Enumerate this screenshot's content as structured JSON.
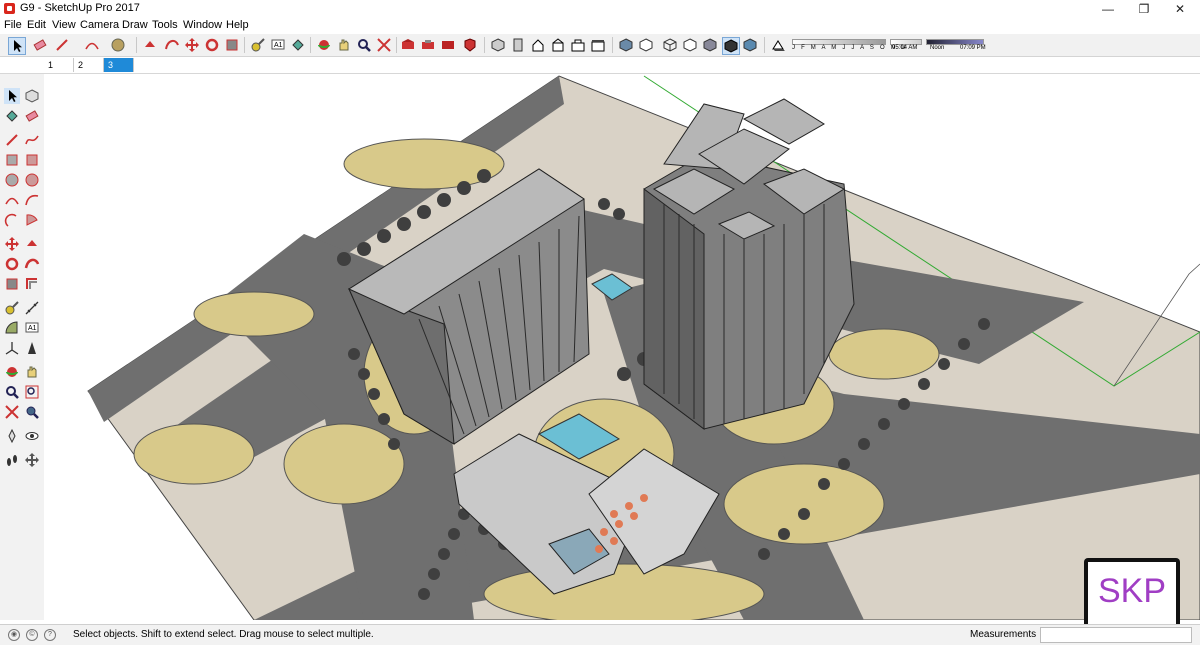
{
  "window": {
    "title": "G9 - SketchUp Pro 2017",
    "controls": {
      "minimize": "—",
      "restore": "❐",
      "close": "✕"
    }
  },
  "menu": {
    "items": [
      "File",
      "Edit",
      "View",
      "Camera",
      "Draw",
      "Tools",
      "Window",
      "Help"
    ]
  },
  "toolbar": {
    "months_label": "J F M A M J J A S O N D",
    "time_start": "05:04 AM",
    "time_mid": "Noon",
    "time_end": "07:09 PM"
  },
  "scenes": {
    "tabs": [
      "1",
      "2",
      "3"
    ],
    "active": "3"
  },
  "status": {
    "hint": "Select objects. Shift to extend select. Drag mouse to select multiple.",
    "measurements_label": "Measurements",
    "measurements_value": ""
  },
  "watermark": {
    "text": "SKP"
  },
  "colors": {
    "accent": "#1f8ad8",
    "road": "#6f6f6f",
    "sand": "#d8c98a",
    "ground": "#d9d2c6",
    "skp_text": "#a03ec4"
  }
}
